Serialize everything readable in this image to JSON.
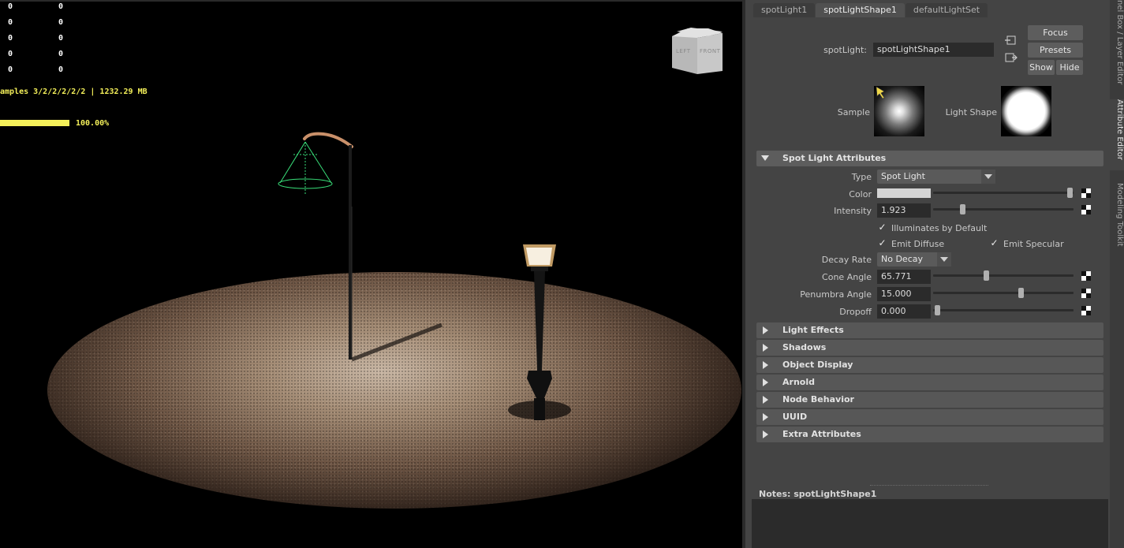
{
  "viewport": {
    "hud_rows": [
      [
        "0",
        "0"
      ],
      [
        "0",
        "0"
      ],
      [
        "0",
        "0"
      ],
      [
        "0",
        "0"
      ],
      [
        "0",
        "0"
      ]
    ],
    "samples_text": "amples 3/2/2/2/2/2 | 1232.29 MB",
    "progress_text": "100.00%",
    "progress_fraction": 1.0,
    "viewcube": {
      "left": "LEFT",
      "front": "FRONT"
    }
  },
  "attribute_editor": {
    "tabs": [
      "spotLight1",
      "spotLightShape1",
      "defaultLightSet"
    ],
    "active_tab": "spotLightShape1",
    "node_label": "spotLight:",
    "node_value": "spotLightShape1",
    "buttons": {
      "focus": "Focus",
      "presets": "Presets",
      "show": "Show",
      "hide": "Hide"
    },
    "sample_label": "Sample",
    "light_shape_label": "Light Shape",
    "sections": {
      "spot": "Spot Light Attributes",
      "collapsed": [
        "Light Effects",
        "Shadows",
        "Object Display",
        "Arnold",
        "Node Behavior",
        "UUID",
        "Extra Attributes"
      ]
    },
    "attrs": {
      "type_label": "Type",
      "type_value": "Spot Light",
      "color_label": "Color",
      "color_value": "#d4d4d4",
      "intensity_label": "Intensity",
      "intensity_value": "1.923",
      "illuminates_label": "Illuminates by Default",
      "emit_diffuse_label": "Emit Diffuse",
      "emit_specular_label": "Emit Specular",
      "decay_label": "Decay Rate",
      "decay_value": "No Decay",
      "cone_label": "Cone Angle",
      "cone_value": "65.771",
      "penumbra_label": "Penumbra Angle",
      "penumbra_value": "15.000",
      "dropoff_label": "Dropoff",
      "dropoff_value": "0.000"
    },
    "notes_label": "Notes:  spotLightShape1"
  },
  "side_tabs": [
    "nel Box / Layer Editor",
    "Attribute Editor",
    "Modeling Toolkit"
  ],
  "colors": {
    "hud_yellow": "#f4f05a",
    "cone_green": "#39e07a",
    "panel_bg": "#444444"
  }
}
